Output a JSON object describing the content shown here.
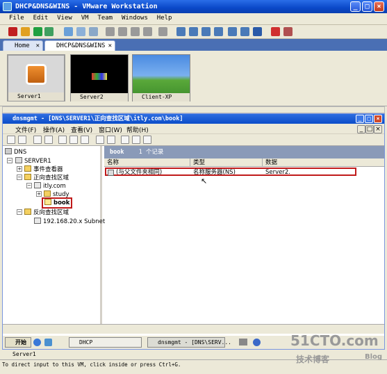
{
  "window": {
    "title": "DHCP&DNS&WINS - VMware Workstation"
  },
  "menu": [
    "File",
    "Edit",
    "View",
    "VM",
    "Team",
    "Windows",
    "Help"
  ],
  "tabs": [
    {
      "label": "Home"
    },
    {
      "label": "DHCP&DNS&WINS"
    }
  ],
  "thumbnails": [
    {
      "label": "Server1"
    },
    {
      "label": "Server2"
    },
    {
      "label": "Client-XP"
    }
  ],
  "mmc": {
    "title": "dnsmgmt - [DNS\\SERVER1\\正向查找区域\\itly.com\\book]",
    "menu": [
      "文件(F)",
      "操作(A)",
      "查看(V)",
      "窗口(W)",
      "帮助(H)"
    ]
  },
  "tree": {
    "root": "DNS",
    "server": "SERVER1",
    "event_viewer": "事件查看器",
    "forward_zones": "正向查找区域",
    "zone": "itly.com",
    "study": "study",
    "book": "book",
    "reverse_zones": "反向查找区域",
    "subnet": "192.168.20.x Subnet"
  },
  "pane": {
    "header_name": "book",
    "header_count": "1 个记录",
    "columns": [
      "名称",
      "类型",
      "数据"
    ],
    "record": {
      "name": "(与父文件夹相同)",
      "type": "名称服务器(NS)",
      "data": "Server2."
    }
  },
  "guest_taskbar": {
    "start": "开始",
    "items": [
      "DHCP",
      "dnsmgmt - [DNS\\SERV..."
    ]
  },
  "status": {
    "vm": "Server1",
    "hint": "To direct input to this VM, click inside or press Ctrl+G."
  },
  "watermark": {
    "line1": "51CTO.com",
    "line2": "技术博客",
    "line3": "Blog"
  }
}
